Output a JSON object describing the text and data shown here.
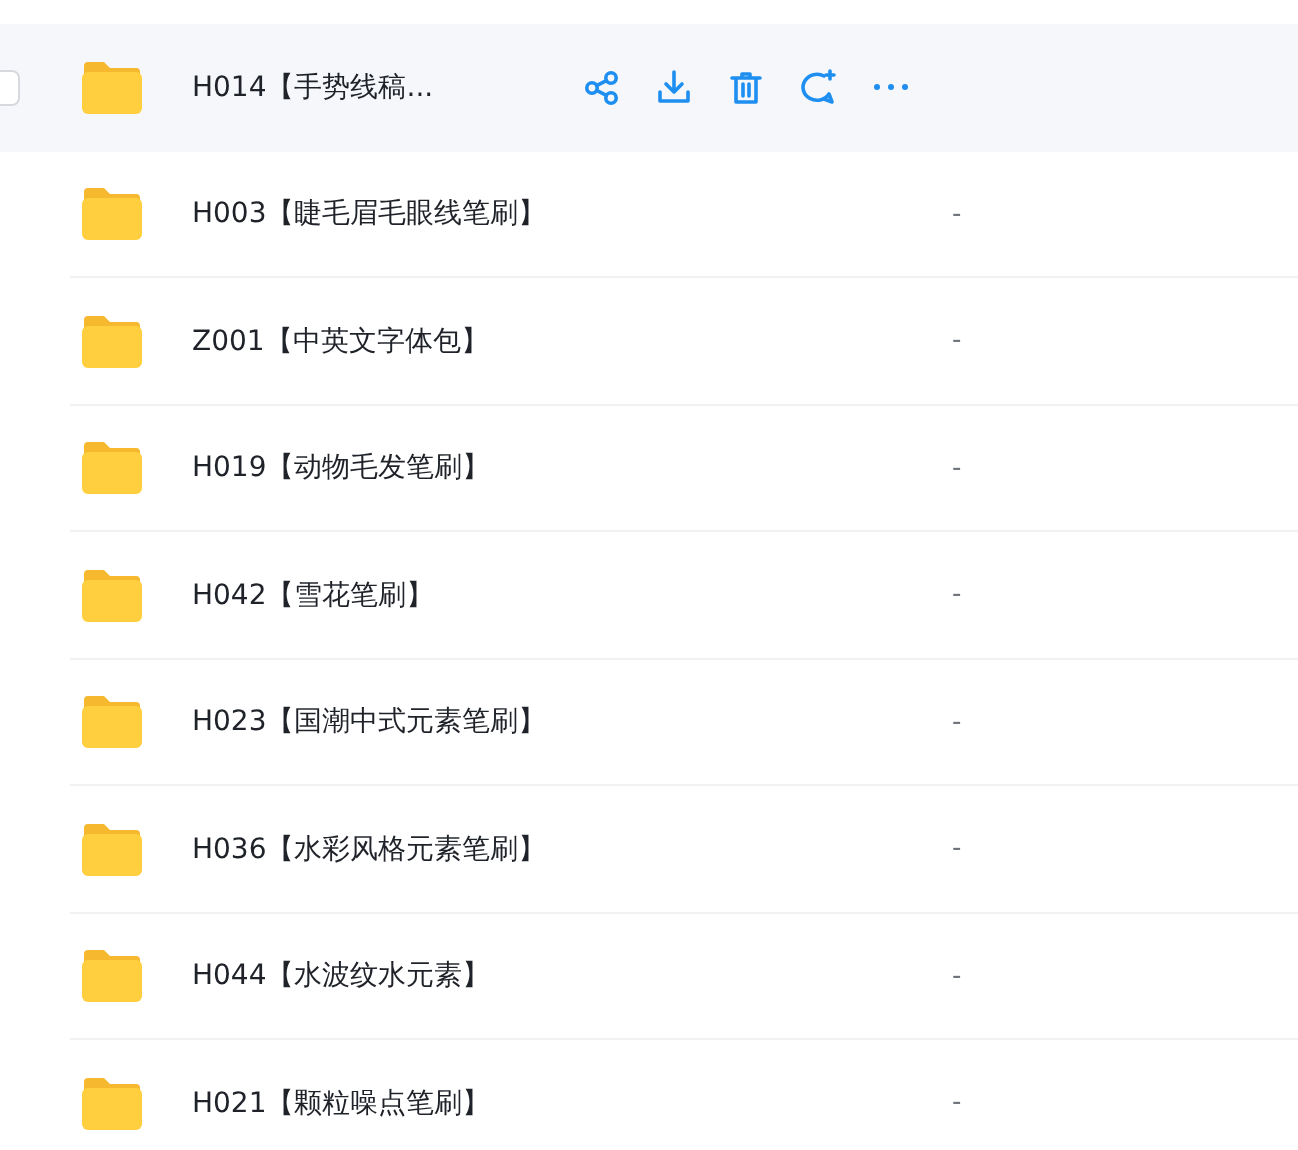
{
  "rows": [
    {
      "name": "H014【手势线稿...",
      "hovered": true,
      "checkbox": {
        "checked": false
      }
    },
    {
      "name": "H003【睫毛眉毛眼线笔刷】",
      "column_2": "-",
      "hovered": false
    },
    {
      "name": "Z001【中英文字体包】",
      "column_2": "-",
      "hovered": false
    },
    {
      "name": "H019【动物毛发笔刷】",
      "column_2": "-",
      "hovered": false
    },
    {
      "name": "H042【雪花笔刷】",
      "column_2": "-",
      "hovered": false
    },
    {
      "name": "H023【国潮中式元素笔刷】",
      "column_2": "-",
      "hovered": false
    },
    {
      "name": "H036【水彩风格元素笔刷】",
      "column_2": "-",
      "hovered": false
    },
    {
      "name": "H044【水波纹水元素】",
      "column_2": "-",
      "hovered": false
    },
    {
      "name": "H021【颗粒噪点笔刷】",
      "column_2": "-",
      "hovered": false
    }
  ]
}
